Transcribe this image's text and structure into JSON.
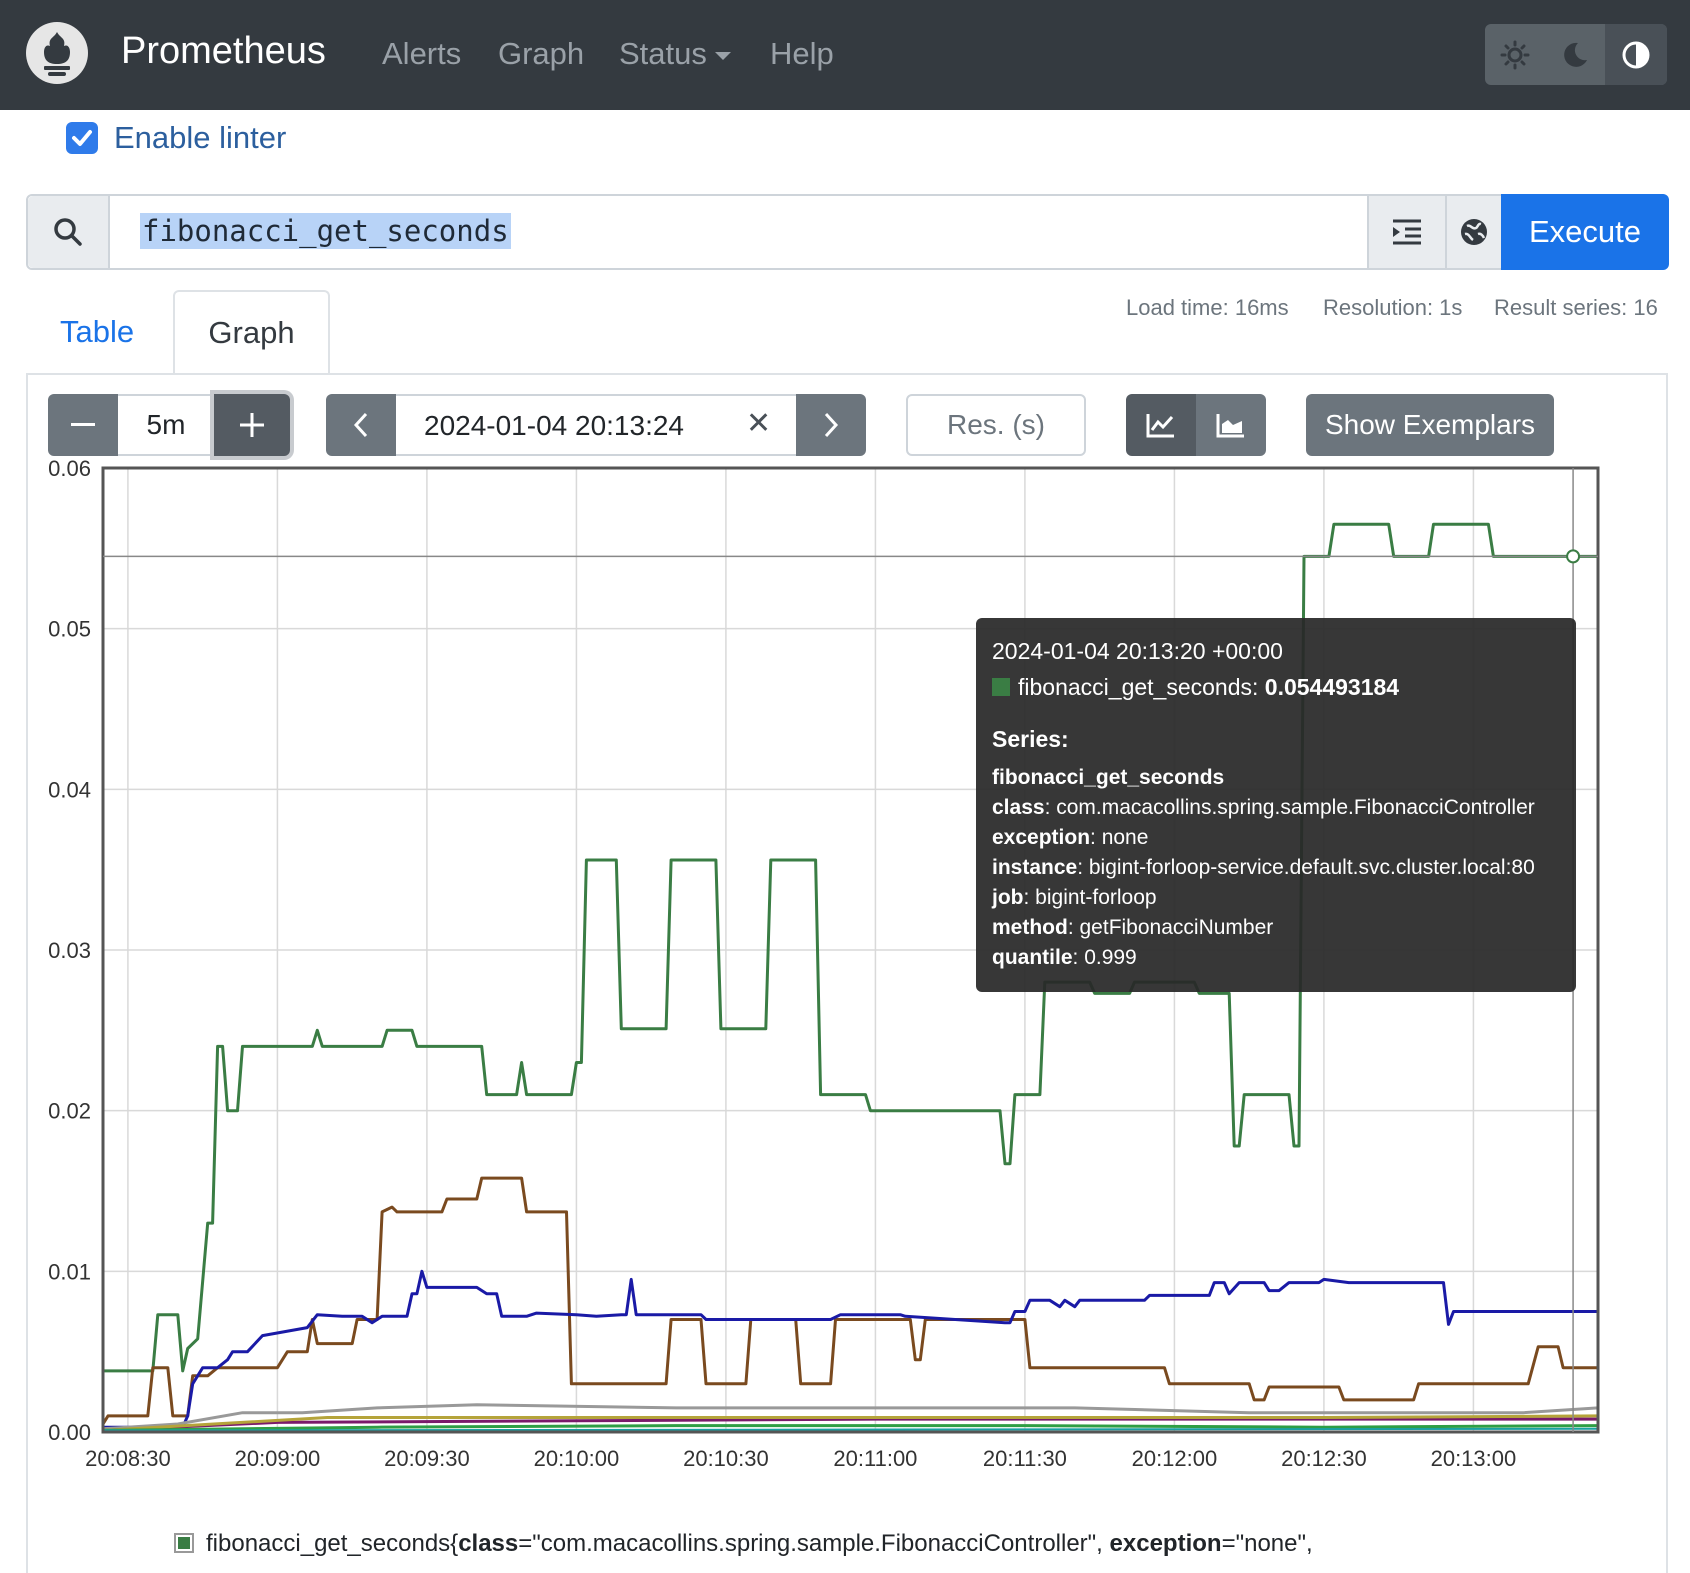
{
  "nav": {
    "brand": "Prometheus",
    "links": [
      "Alerts",
      "Graph",
      "Status",
      "Help"
    ],
    "theme_icons": [
      "sun-icon",
      "moon-icon",
      "contrast-icon"
    ]
  },
  "linter": {
    "label": "Enable linter",
    "checked": true
  },
  "query": {
    "expression": "fibonacci_get_seconds",
    "execute_label": "Execute",
    "icons": [
      "search-icon",
      "format-icon",
      "metrics-explorer-icon"
    ]
  },
  "tabs": {
    "table": "Table",
    "graph": "Graph",
    "active": "Graph"
  },
  "stats": {
    "load_time": "Load time: 16ms",
    "resolution": "Resolution: 1s",
    "result_series": "Result series: 16"
  },
  "controls": {
    "range_value": "5m",
    "range_minus": "−",
    "range_plus": "+",
    "end_time": "2024-01-04 20:13:24",
    "clear": "✕",
    "res_placeholder": "Res. (s)",
    "exemplars_label": "Show Exemplars",
    "stacked": false
  },
  "tooltip": {
    "time": "2024-01-04 20:13:20 +00:00",
    "metric": "fibonacci_get_seconds",
    "value": "0.054493184",
    "series_heading": "Series:",
    "series_name": "fibonacci_get_seconds",
    "labels": [
      {
        "key": "class",
        "value": "com.macacollins.spring.sample.FibonacciController"
      },
      {
        "key": "exception",
        "value": "none"
      },
      {
        "key": "instance",
        "value": "bigint-forloop-service.default.svc.cluster.local:80"
      },
      {
        "key": "job",
        "value": "bigint-forloop"
      },
      {
        "key": "method",
        "value": "getFibonacciNumber"
      },
      {
        "key": "quantile",
        "value": "0.999"
      }
    ]
  },
  "legend": {
    "metric": "fibonacci_get_seconds",
    "open": "{",
    "k1": "class",
    "v1": "=\"com.macacollins.spring.sample.FibonacciController\", ",
    "k2": "exception",
    "v2": "=\"none\","
  },
  "chart_data": {
    "type": "line",
    "title": "",
    "xlabel": "",
    "ylabel": "",
    "ylim": [
      0,
      0.06
    ],
    "xlim": [
      "20:08:25",
      "20:13:25"
    ],
    "yticks": [
      "0.00",
      "0.01",
      "0.02",
      "0.03",
      "0.04",
      "0.05",
      "0.06"
    ],
    "xticks": [
      "20:08:30",
      "20:09:00",
      "20:09:30",
      "20:10:00",
      "20:10:30",
      "20:11:00",
      "20:11:30",
      "20:12:00",
      "20:12:30",
      "20:13:00"
    ],
    "grid": true,
    "hover_y": 0.0545,
    "series": [
      {
        "color": "#3a7d44",
        "width": 3,
        "points": [
          [
            "20:08:25",
            0.0038
          ],
          [
            "20:08:35",
            0.0038
          ],
          [
            "20:08:36",
            0.0073
          ],
          [
            "20:08:40",
            0.0073
          ],
          [
            "20:08:41",
            0.0038
          ],
          [
            "20:08:42",
            0.0052
          ],
          [
            "20:08:44",
            0.0058
          ],
          [
            "20:08:46",
            0.013
          ],
          [
            "20:08:47",
            0.013
          ],
          [
            "20:08:48",
            0.024
          ],
          [
            "20:08:49",
            0.024
          ],
          [
            "20:08:50",
            0.02
          ],
          [
            "20:08:52",
            0.02
          ],
          [
            "20:08:53",
            0.024
          ],
          [
            "20:09:07",
            0.024
          ],
          [
            "20:09:08",
            0.025
          ],
          [
            "20:09:09",
            0.024
          ],
          [
            "20:09:21",
            0.024
          ],
          [
            "20:09:22",
            0.025
          ],
          [
            "20:09:27",
            0.025
          ],
          [
            "20:09:28",
            0.024
          ],
          [
            "20:09:41",
            0.024
          ],
          [
            "20:09:42",
            0.021
          ],
          [
            "20:09:48",
            0.021
          ],
          [
            "20:09:49",
            0.023
          ],
          [
            "20:09:50",
            0.021
          ],
          [
            "20:09:59",
            0.021
          ],
          [
            "20:10:00",
            0.023
          ],
          [
            "20:10:01",
            0.023
          ],
          [
            "20:10:02",
            0.0356
          ],
          [
            "20:10:08",
            0.0356
          ],
          [
            "20:10:09",
            0.0251
          ],
          [
            "20:10:18",
            0.0251
          ],
          [
            "20:10:19",
            0.0356
          ],
          [
            "20:10:28",
            0.0356
          ],
          [
            "20:10:29",
            0.0251
          ],
          [
            "20:10:38",
            0.0251
          ],
          [
            "20:10:39",
            0.0356
          ],
          [
            "20:10:48",
            0.0356
          ],
          [
            "20:10:49",
            0.021
          ],
          [
            "20:10:58",
            0.021
          ],
          [
            "20:10:59",
            0.02
          ],
          [
            "20:11:25",
            0.02
          ],
          [
            "20:11:26",
            0.0167
          ],
          [
            "20:11:27",
            0.0167
          ],
          [
            "20:11:28",
            0.021
          ],
          [
            "20:11:33",
            0.021
          ],
          [
            "20:11:34",
            0.028
          ],
          [
            "20:11:43",
            0.028
          ],
          [
            "20:11:44",
            0.0273
          ],
          [
            "20:11:51",
            0.0273
          ],
          [
            "20:11:52",
            0.028
          ],
          [
            "20:12:04",
            0.028
          ],
          [
            "20:12:05",
            0.0273
          ],
          [
            "20:12:11",
            0.0273
          ],
          [
            "20:12:12",
            0.0178
          ],
          [
            "20:12:13",
            0.0178
          ],
          [
            "20:12:14",
            0.021
          ],
          [
            "20:12:23",
            0.021
          ],
          [
            "20:12:24",
            0.0178
          ],
          [
            "20:12:25",
            0.0178
          ],
          [
            "20:12:26",
            0.0545
          ],
          [
            "20:12:31",
            0.0545
          ],
          [
            "20:12:32",
            0.0565
          ],
          [
            "20:12:43",
            0.0565
          ],
          [
            "20:12:44",
            0.0545
          ],
          [
            "20:12:51",
            0.0545
          ],
          [
            "20:12:52",
            0.0565
          ],
          [
            "20:13:03",
            0.0565
          ],
          [
            "20:13:04",
            0.0545
          ],
          [
            "20:13:25",
            0.0545
          ]
        ]
      },
      {
        "color": "#7a4a1f",
        "width": 3,
        "points": [
          [
            "20:08:25",
            0.0005
          ],
          [
            "20:08:26",
            0.001
          ],
          [
            "20:08:34",
            0.001
          ],
          [
            "20:08:35",
            0.004
          ],
          [
            "20:08:38",
            0.004
          ],
          [
            "20:08:39",
            0.001
          ],
          [
            "20:08:42",
            0.001
          ],
          [
            "20:08:43",
            0.0035
          ],
          [
            "20:08:46",
            0.0035
          ],
          [
            "20:08:48",
            0.004
          ],
          [
            "20:09:00",
            0.004
          ],
          [
            "20:09:02",
            0.005
          ],
          [
            "20:09:06",
            0.005
          ],
          [
            "20:09:07",
            0.007
          ],
          [
            "20:09:08",
            0.0055
          ],
          [
            "20:09:15",
            0.0055
          ],
          [
            "20:09:16",
            0.007
          ],
          [
            "20:09:20",
            0.007
          ],
          [
            "20:09:21",
            0.0137
          ],
          [
            "20:09:23",
            0.014
          ],
          [
            "20:09:24",
            0.0137
          ],
          [
            "20:09:33",
            0.0137
          ],
          [
            "20:09:34",
            0.0145
          ],
          [
            "20:09:40",
            0.0145
          ],
          [
            "20:09:41",
            0.0158
          ],
          [
            "20:09:49",
            0.0158
          ],
          [
            "20:09:50",
            0.0137
          ],
          [
            "20:09:58",
            0.0137
          ],
          [
            "20:09:59",
            0.003
          ],
          [
            "20:10:18",
            0.003
          ],
          [
            "20:10:19",
            0.007
          ],
          [
            "20:10:25",
            0.007
          ],
          [
            "20:10:26",
            0.003
          ],
          [
            "20:10:34",
            0.003
          ],
          [
            "20:10:35",
            0.007
          ],
          [
            "20:10:44",
            0.007
          ],
          [
            "20:10:45",
            0.003
          ],
          [
            "20:10:51",
            0.003
          ],
          [
            "20:10:52",
            0.007
          ],
          [
            "20:11:07",
            0.007
          ],
          [
            "20:11:08",
            0.0045
          ],
          [
            "20:11:09",
            0.0045
          ],
          [
            "20:11:10",
            0.007
          ],
          [
            "20:11:30",
            0.007
          ],
          [
            "20:11:31",
            0.004
          ],
          [
            "20:11:58",
            0.004
          ],
          [
            "20:11:59",
            0.003
          ],
          [
            "20:12:15",
            0.003
          ],
          [
            "20:12:16",
            0.002
          ],
          [
            "20:12:18",
            0.002
          ],
          [
            "20:12:19",
            0.0028
          ],
          [
            "20:12:33",
            0.0028
          ],
          [
            "20:12:34",
            0.002
          ],
          [
            "20:12:48",
            0.002
          ],
          [
            "20:12:49",
            0.003
          ],
          [
            "20:13:11",
            0.003
          ],
          [
            "20:13:13",
            0.0053
          ],
          [
            "20:13:17",
            0.0053
          ],
          [
            "20:13:18",
            0.004
          ],
          [
            "20:13:25",
            0.004
          ]
        ]
      },
      {
        "color": "#1a1aa6",
        "width": 3,
        "points": [
          [
            "20:08:25",
            0.0003
          ],
          [
            "20:08:41",
            0.0003
          ],
          [
            "20:08:42",
            0.001
          ],
          [
            "20:08:43",
            0.003
          ],
          [
            "20:08:45",
            0.004
          ],
          [
            "20:08:48",
            0.004
          ],
          [
            "20:08:50",
            0.0045
          ],
          [
            "20:08:51",
            0.005
          ],
          [
            "20:08:54",
            0.005
          ],
          [
            "20:08:57",
            0.006
          ],
          [
            "20:09:06",
            0.0065
          ],
          [
            "20:09:08",
            0.0073
          ],
          [
            "20:09:13",
            0.0072
          ],
          [
            "20:09:17",
            0.0072
          ],
          [
            "20:09:19",
            0.0068
          ],
          [
            "20:09:21",
            0.0072
          ],
          [
            "20:09:26",
            0.0072
          ],
          [
            "20:09:27",
            0.0086
          ],
          [
            "20:09:28",
            0.0086
          ],
          [
            "20:09:29",
            0.01
          ],
          [
            "20:09:30",
            0.009
          ],
          [
            "20:09:40",
            0.009
          ],
          [
            "20:09:42",
            0.0086
          ],
          [
            "20:09:44",
            0.0086
          ],
          [
            "20:09:45",
            0.0072
          ],
          [
            "20:09:50",
            0.0072
          ],
          [
            "20:09:52",
            0.0074
          ],
          [
            "20:10:00",
            0.0073
          ],
          [
            "20:10:04",
            0.0072
          ],
          [
            "20:10:09",
            0.0073
          ],
          [
            "20:10:10",
            0.0073
          ],
          [
            "20:10:11",
            0.0095
          ],
          [
            "20:10:12",
            0.0073
          ],
          [
            "20:10:25",
            0.0073
          ],
          [
            "20:10:26",
            0.007
          ],
          [
            "20:10:51",
            0.007
          ],
          [
            "20:10:53",
            0.0073
          ],
          [
            "20:11:05",
            0.0073
          ],
          [
            "20:11:06",
            0.0072
          ],
          [
            "20:11:26",
            0.0068
          ],
          [
            "20:11:27",
            0.0068
          ],
          [
            "20:11:28",
            0.0075
          ],
          [
            "20:11:30",
            0.0075
          ],
          [
            "20:11:31",
            0.0082
          ],
          [
            "20:11:35",
            0.0082
          ],
          [
            "20:11:37",
            0.0078
          ],
          [
            "20:11:38",
            0.0082
          ],
          [
            "20:11:40",
            0.0078
          ],
          [
            "20:11:41",
            0.0082
          ],
          [
            "20:11:54",
            0.0082
          ],
          [
            "20:11:55",
            0.0085
          ],
          [
            "20:12:07",
            0.0085
          ],
          [
            "20:12:08",
            0.0093
          ],
          [
            "20:12:10",
            0.0093
          ],
          [
            "20:12:11",
            0.0086
          ],
          [
            "20:12:13",
            0.0093
          ],
          [
            "20:12:18",
            0.0093
          ],
          [
            "20:12:19",
            0.0088
          ],
          [
            "20:12:21",
            0.0088
          ],
          [
            "20:12:23",
            0.0093
          ],
          [
            "20:12:29",
            0.0093
          ],
          [
            "20:12:30",
            0.0095
          ],
          [
            "20:12:35",
            0.0093
          ],
          [
            "20:12:54",
            0.0093
          ],
          [
            "20:12:55",
            0.0067
          ],
          [
            "20:12:56",
            0.0075
          ],
          [
            "20:13:03",
            0.0075
          ],
          [
            "20:13:10",
            0.0075
          ],
          [
            "20:13:20",
            0.0075
          ],
          [
            "20:13:25",
            0.0075
          ]
        ]
      },
      {
        "color": "#999999",
        "width": 3,
        "points": [
          [
            "20:08:25",
            0.0002
          ],
          [
            "20:08:40",
            0.0005
          ],
          [
            "20:08:53",
            0.0012
          ],
          [
            "20:09:05",
            0.0012
          ],
          [
            "20:09:20",
            0.0015
          ],
          [
            "20:09:40",
            0.0017
          ],
          [
            "20:10:20",
            0.0015
          ],
          [
            "20:11:00",
            0.0015
          ],
          [
            "20:11:40",
            0.0015
          ],
          [
            "20:12:15",
            0.0012
          ],
          [
            "20:12:40",
            0.0012
          ],
          [
            "20:13:10",
            0.0012
          ],
          [
            "20:13:25",
            0.0015
          ]
        ]
      },
      {
        "color": "#7a1a6a",
        "width": 3,
        "points": [
          [
            "20:08:25",
            0.0001
          ],
          [
            "20:09:00",
            0.0006
          ],
          [
            "20:10:00",
            0.0007
          ],
          [
            "20:11:00",
            0.0008
          ],
          [
            "20:12:00",
            0.0008
          ],
          [
            "20:13:25",
            0.0008
          ]
        ]
      },
      {
        "color": "#b5a43a",
        "width": 3,
        "points": [
          [
            "20:08:25",
            0.0001
          ],
          [
            "20:09:10",
            0.0009
          ],
          [
            "20:10:20",
            0.0009
          ],
          [
            "20:11:30",
            0.0009
          ],
          [
            "20:12:30",
            0.0009
          ],
          [
            "20:13:25",
            0.001
          ]
        ]
      },
      {
        "color": "#2f9e44",
        "width": 3,
        "points": [
          [
            "20:08:25",
            0.0001
          ],
          [
            "20:09:20",
            0.0003
          ],
          [
            "20:10:20",
            0.0004
          ],
          [
            "20:11:30",
            0.0004
          ],
          [
            "20:12:30",
            0.0003
          ],
          [
            "20:13:25",
            0.0004
          ]
        ]
      },
      {
        "color": "#1aa0a0",
        "width": 2,
        "points": [
          [
            "20:08:25",
            0.0001
          ],
          [
            "20:13:25",
            0.0002
          ]
        ]
      }
    ]
  }
}
